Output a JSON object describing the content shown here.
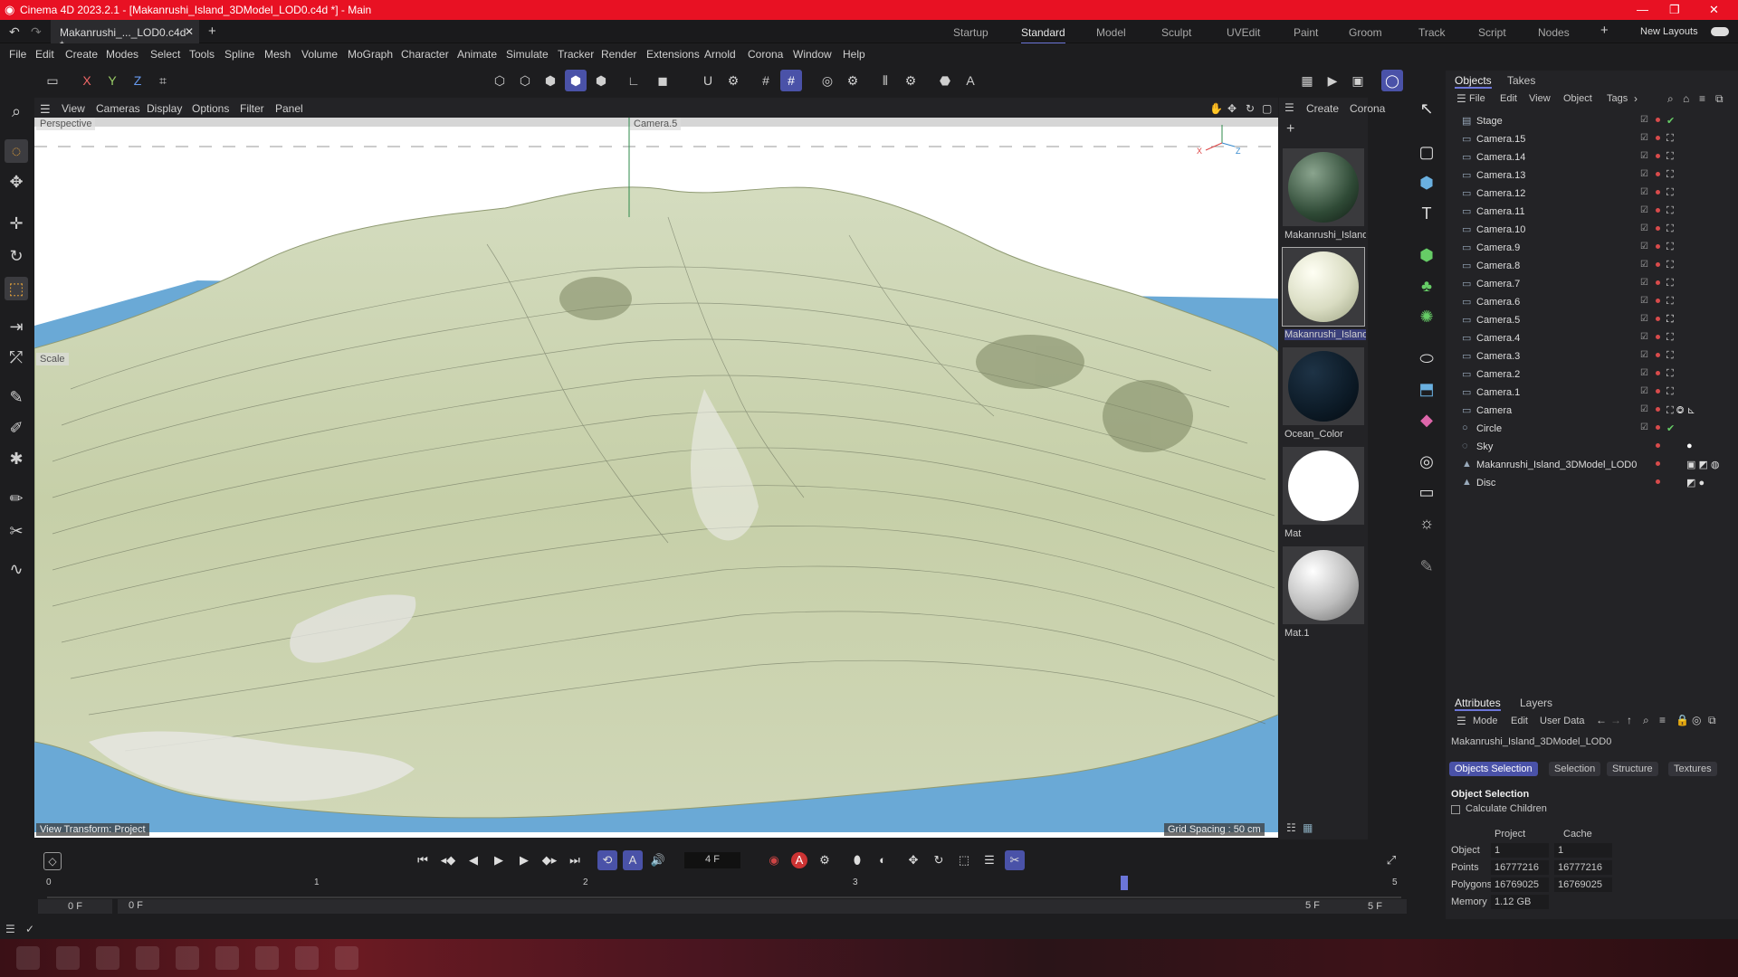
{
  "titlebar": {
    "title": "Cinema 4D 2023.2.1 - [Makanrushi_Island_3DModel_LOD0.c4d *] - Main"
  },
  "tabs": {
    "doc_tab": "Makanrushi_..._LOD0.c4d *",
    "layouts": [
      "Startup",
      "Standard",
      "Model",
      "Sculpt",
      "UVEdit",
      "Paint",
      "Groom",
      "Track",
      "Script",
      "Nodes"
    ],
    "active_layout": "Standard",
    "new_layouts": "New Layouts"
  },
  "menu": [
    "File",
    "Edit",
    "Create",
    "Modes",
    "Select",
    "Tools",
    "Spline",
    "Mesh",
    "Volume",
    "MoGraph",
    "Character",
    "Animate",
    "Simulate",
    "Tracker",
    "Render",
    "Extensions",
    "Arnold",
    "Corona",
    "Window",
    "Help"
  ],
  "axis_buttons": [
    "X",
    "Y",
    "Z"
  ],
  "viewport_menu": [
    "View",
    "Cameras",
    "Display",
    "Options",
    "Filter",
    "Panel"
  ],
  "viewport": {
    "label_left": "Perspective",
    "label_camera": "Camera.5",
    "scale_label": "Scale",
    "view_transform": "View Transform: Project",
    "grid_spacing": "Grid Spacing : 50 cm",
    "axis_x": "X",
    "axis_z": "Z",
    "terrain_color": "#c9d4b0",
    "water_color": "#6aa9d6"
  },
  "material_panel": {
    "menu": [
      "Create",
      "Corona"
    ],
    "materials": [
      {
        "name": "Makanrushi_Island",
        "color": "#2f4a36"
      },
      {
        "name": "Makanrushi_Island",
        "color": "#d9dcc2"
      },
      {
        "name": "Ocean_Color",
        "color": "#0c1a26"
      },
      {
        "name": "Mat",
        "color": "#ffffff"
      },
      {
        "name": "Mat.1",
        "color": "#bdbdbd"
      }
    ]
  },
  "objects_panel": {
    "tabs": [
      "Objects",
      "Takes"
    ],
    "menu": [
      "File",
      "Edit",
      "View",
      "Object",
      "Tags"
    ],
    "items": [
      {
        "name": "Stage",
        "icon": "stage-icon"
      },
      {
        "name": "Camera.15",
        "icon": "camera-icon"
      },
      {
        "name": "Camera.14",
        "icon": "camera-icon"
      },
      {
        "name": "Camera.13",
        "icon": "camera-icon"
      },
      {
        "name": "Camera.12",
        "icon": "camera-icon"
      },
      {
        "name": "Camera.11",
        "icon": "camera-icon"
      },
      {
        "name": "Camera.10",
        "icon": "camera-icon"
      },
      {
        "name": "Camera.9",
        "icon": "camera-icon"
      },
      {
        "name": "Camera.8",
        "icon": "camera-icon"
      },
      {
        "name": "Camera.7",
        "icon": "camera-icon"
      },
      {
        "name": "Camera.6",
        "icon": "camera-icon"
      },
      {
        "name": "Camera.5",
        "icon": "camera-icon"
      },
      {
        "name": "Camera.4",
        "icon": "camera-icon"
      },
      {
        "name": "Camera.3",
        "icon": "camera-icon"
      },
      {
        "name": "Camera.2",
        "icon": "camera-icon"
      },
      {
        "name": "Camera.1",
        "icon": "camera-icon"
      },
      {
        "name": "Camera",
        "icon": "camera-icon"
      },
      {
        "name": "Circle",
        "icon": "circle-icon"
      },
      {
        "name": "Sky",
        "icon": "sky-icon"
      },
      {
        "name": "Makanrushi_Island_3DModel_LOD0",
        "icon": "polygon-object-icon"
      },
      {
        "name": "Disc",
        "icon": "disc-icon"
      }
    ]
  },
  "attributes": {
    "tabs": [
      "Attributes",
      "Layers"
    ],
    "menu": [
      "Mode",
      "Edit",
      "User Data"
    ],
    "object_name": "Makanrushi_Island_3DModel_LOD0",
    "sub_tabs": [
      "Objects Selection",
      "Selection",
      "Structure",
      "Textures"
    ],
    "section_title": "Object Selection",
    "calc_children": "Calculate Children",
    "columns": [
      "Project",
      "Cache"
    ],
    "rows": [
      {
        "label": "Object",
        "project": "1",
        "cache": "1"
      },
      {
        "label": "Points",
        "project": "16777216",
        "cache": "16777216"
      },
      {
        "label": "Polygons",
        "project": "16769025",
        "cache": "16769025"
      },
      {
        "label": "Memory",
        "project": "1.12 GB",
        "cache": ""
      }
    ]
  },
  "timeline": {
    "current_frame": "4 F",
    "ruler_labels": [
      "0",
      "1",
      "2",
      "3",
      "4",
      "5"
    ],
    "start": "0 F",
    "start2": "0 F",
    "end": "5 F",
    "end2": "5 F",
    "playhead_frame": 4
  }
}
